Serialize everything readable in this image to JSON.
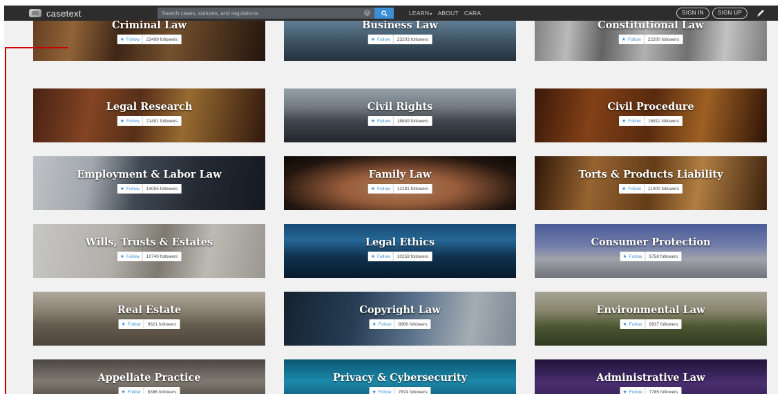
{
  "navbar": {
    "brand": "casetext",
    "search_placeholder": "Search cases, statutes, and regulations",
    "links": [
      "LEARN",
      "ABOUT",
      "CARA"
    ],
    "learn_caret": "▾",
    "sign_in": "SIGN IN",
    "sign_up": "SIGN UP"
  },
  "follow_label": "Follow",
  "topics": [
    {
      "title": "Criminal Law",
      "followers": "23499 followers",
      "bg": "linear-gradient(100deg,#7a4a2a 0%,#b07a44 18%,#4c2f1c 38%,#8d6238 60%,#2c1a10 100%)"
    },
    {
      "title": "Business Law",
      "followers": "23203 followers",
      "bg": "linear-gradient(180deg,#8fb3cf 0%,#6d8ea8 35%,#4a6478 65%,#2e3e4c 100%)"
    },
    {
      "title": "Constitutional Law",
      "followers": "22200 followers",
      "bg": "linear-gradient(95deg,#9c9c9c 0%,#e3e3e3 15%,#7a7a7a 30%,#d8d8d8 48%,#8a8a8a 66%,#eeeeee 82%,#9a9a9a 100%)"
    },
    {
      "title": "Legal Research",
      "followers": "21491 followers",
      "bg": "linear-gradient(100deg,#5a2a18 0%,#a0542c 25%,#6b3a1e 45%,#b8823c 65%,#3c1e10 100%)"
    },
    {
      "title": "Civil Rights",
      "followers": "18849 followers",
      "bg": "linear-gradient(180deg,#b7c4cf 0%,#8b949d 35%,#4f5660 60%,#2b2f36 100%)"
    },
    {
      "title": "Civil Procedure",
      "followers": "16811 followers",
      "bg": "linear-gradient(100deg,#4a1e0c 0%,#a0501c 25%,#6c3412 50%,#c0762c 72%,#3a1808 100%)"
    },
    {
      "title": "Employment & Labor Law",
      "followers": "14055 followers",
      "bg": "linear-gradient(100deg,#e9edf1 0%,#c5ccd4 25%,#4e5966 45%,#2c3440 70%,#1a2029 100%)"
    },
    {
      "title": "Family Law",
      "followers": "12281 followers",
      "bg": "radial-gradient(ellipse at 50% 60%,#d79a6c 0%,#b87148 35%,#2a1a12 75%,#120b07 100%)"
    },
    {
      "title": "Torts & Products Liability",
      "followers": "11000 followers",
      "bg": "linear-gradient(100deg,#3a1c0a 0%,#b87a3c 25%,#7a4a1e 50%,#d89a52 70%,#4a2a12 100%)"
    },
    {
      "title": "Wills, Trusts & Estates",
      "followers": "10740 followers",
      "bg": "linear-gradient(100deg,#f2f2ef 0%,#d8d6cf 35%,#9a958a 55%,#e6e3dc 75%,#bcb8ae 100%)"
    },
    {
      "title": "Legal Ethics",
      "followers": "10259 followers",
      "bg": "linear-gradient(180deg,#1b5a8c 0%,#2f7fb8 30%,#143d62 60%,#0b2238 100%)"
    },
    {
      "title": "Consumer Protection",
      "followers": "9758 followers",
      "bg": "linear-gradient(180deg,#5a6fb8 0%,#8b9ad0 40%,#c2c6cf 65%,#8a8f96 100%)"
    },
    {
      "title": "Real Estate",
      "followers": "9621 followers",
      "bg": "linear-gradient(180deg,#d6cfc0 0%,#a99f8c 35%,#7d7362 60%,#5c5446 100%)"
    },
    {
      "title": "Copyright Law",
      "followers": "8966 followers",
      "bg": "linear-gradient(100deg,#1a2a3a 0%,#2e4a66 30%,#6d8aa8 55%,#c9d3dc 80%,#9aa8b6 100%)"
    },
    {
      "title": "Environmental Law",
      "followers": "8937 followers",
      "bg": "linear-gradient(180deg,#cbc9b6 0%,#a7a487 35%,#5d6a3e 65%,#3a4528 100%)"
    },
    {
      "title": "Appellate Practice",
      "followers": "8386 followers",
      "bg": "linear-gradient(180deg,#5b5650 0%,#9d958a 40%,#3a3631 100%)"
    },
    {
      "title": "Privacy & Cybersecurity",
      "followers": "7874 followers",
      "bg": "linear-gradient(180deg,#0d6b8c 0%,#23a7d0 40%,#0c4d6c 100%)"
    },
    {
      "title": "Administrative Law",
      "followers": "7785 followers",
      "bg": "linear-gradient(180deg,#2a1748 0%,#5a3a8a 45%,#2c1a4c 100%)"
    }
  ]
}
